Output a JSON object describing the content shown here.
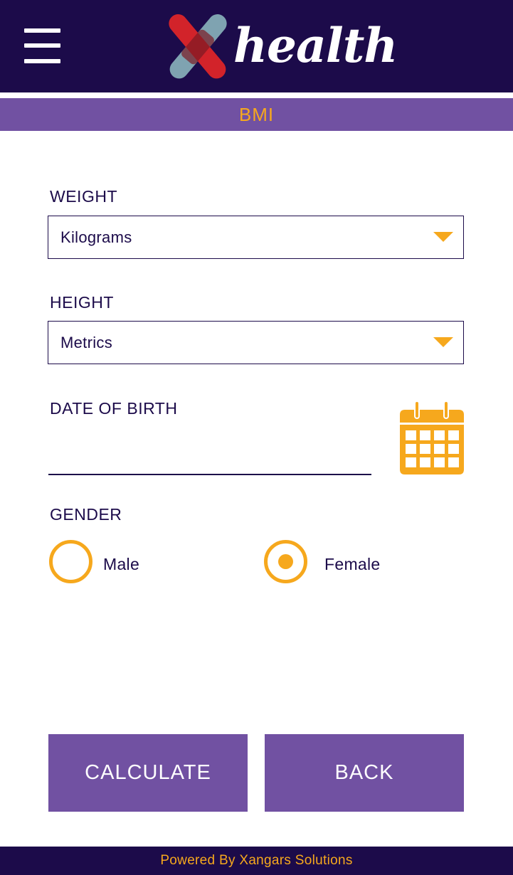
{
  "header": {
    "logo_text": "health",
    "title": "BMI"
  },
  "form": {
    "weight": {
      "label": "WEIGHT",
      "selected": "Kilograms"
    },
    "height": {
      "label": "HEIGHT",
      "selected": "Metrics"
    },
    "dob": {
      "label": "DATE OF BIRTH",
      "value": ""
    },
    "gender": {
      "label": "GENDER",
      "options": [
        {
          "label": "Male",
          "selected": false
        },
        {
          "label": "Female",
          "selected": true
        }
      ]
    }
  },
  "actions": {
    "calculate_label": "CALCULATE",
    "back_label": "BACK"
  },
  "footer": {
    "text": "Powered By Xangars Solutions"
  },
  "colors": {
    "navy": "#1c0b4a",
    "purple": "#7151a2",
    "accent": "#f6a81d"
  },
  "icons": [
    "menu-icon",
    "logo-x-icon",
    "dropdown-arrow-icon",
    "calendar-icon",
    "radio-icon"
  ]
}
